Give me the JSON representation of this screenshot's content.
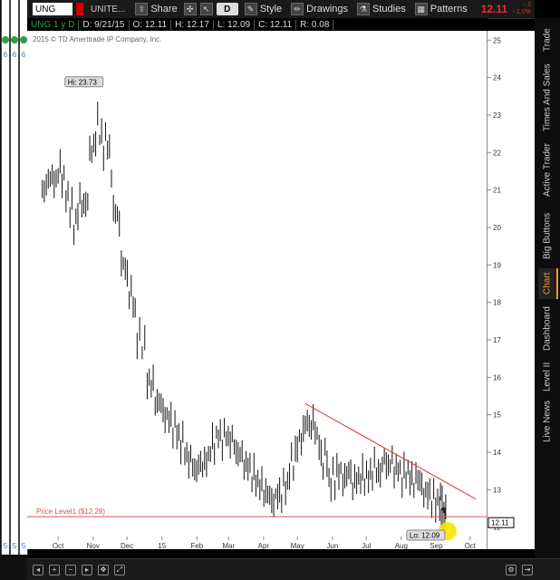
{
  "toolbar": {
    "symbol": "UNG",
    "symbol_name": "UNITE...",
    "share_label": "Share",
    "d_label": "D",
    "style_label": "Style",
    "drawings_label": "Drawings",
    "studies_label": "Studies",
    "patterns_label": "Patterns",
    "last_price": "12.11",
    "change_top": "-.1",
    "change_bottom": "-.1.0%"
  },
  "quote": {
    "symbol_period": "UNG 1 y D",
    "date": "D: 9/21/15",
    "open": "O: 12.11",
    "high": "H: 12.17",
    "low": "L: 12.09",
    "close": "C: 12.11",
    "range": "R: 0.08"
  },
  "chart": {
    "copyright": "2015 © TD Ameritrade IP Company, Inc.",
    "hi_label": "Hi: 23.73",
    "lo_label": "Lo: 12.09",
    "price_level_label": "Price Level1 ($12.28)",
    "last_price_tag": "12.11",
    "colors": {
      "bars": "#111111",
      "trendline": "#e83030",
      "price_level": "#e05050",
      "highlight": "#f5e600"
    }
  },
  "chart_data": {
    "type": "bar",
    "title": "",
    "xlabel": "",
    "ylabel": "",
    "ylim": [
      11.8,
      25.2
    ],
    "y_ticks": [
      12,
      13,
      14,
      15,
      16,
      17,
      18,
      19,
      20,
      21,
      22,
      23,
      24,
      25
    ],
    "x_ticks": [
      "Oct",
      "Nov",
      "Dec",
      "15",
      "Feb",
      "Mar",
      "Apr",
      "May",
      "Jun",
      "Jul",
      "Aug",
      "Sep",
      "Oct"
    ],
    "series": [
      {
        "values": [
          {
            "x": "2014-10-01",
            "y": 20.9
          },
          {
            "x": "2014-10-08",
            "y": 21.9
          },
          {
            "x": "2014-10-15",
            "y": 21.3
          },
          {
            "x": "2014-10-22",
            "y": 20.4
          },
          {
            "x": "2014-10-29",
            "y": 19.4
          },
          {
            "x": "2014-11-05",
            "y": 21.6
          },
          {
            "x": "2014-11-12",
            "y": 22.2
          },
          {
            "x": "2014-11-19",
            "y": 23.4
          },
          {
            "x": "2014-11-26",
            "y": 21.5
          },
          {
            "x": "2014-12-03",
            "y": 19.4
          },
          {
            "x": "2014-12-10",
            "y": 18.9
          },
          {
            "x": "2014-12-17",
            "y": 17.9
          },
          {
            "x": "2014-12-24",
            "y": 16.3
          },
          {
            "x": "2015-01-02",
            "y": 15.6
          },
          {
            "x": "2015-01-09",
            "y": 15.1
          },
          {
            "x": "2015-01-16",
            "y": 14.9
          },
          {
            "x": "2015-01-23",
            "y": 14.6
          },
          {
            "x": "2015-01-30",
            "y": 14.1
          },
          {
            "x": "2015-02-06",
            "y": 13.6
          },
          {
            "x": "2015-02-13",
            "y": 13.4
          },
          {
            "x": "2015-02-20",
            "y": 14.0
          },
          {
            "x": "2015-02-27",
            "y": 14.3
          },
          {
            "x": "2015-03-06",
            "y": 14.6
          },
          {
            "x": "2015-03-13",
            "y": 14.2
          },
          {
            "x": "2015-03-20",
            "y": 13.9
          },
          {
            "x": "2015-03-27",
            "y": 13.6
          },
          {
            "x": "2015-04-03",
            "y": 13.3
          },
          {
            "x": "2015-04-10",
            "y": 13.0
          },
          {
            "x": "2015-04-17",
            "y": 12.8
          },
          {
            "x": "2015-04-24",
            "y": 12.6
          },
          {
            "x": "2015-05-01",
            "y": 13.3
          },
          {
            "x": "2015-05-08",
            "y": 13.9
          },
          {
            "x": "2015-05-15",
            "y": 14.6
          },
          {
            "x": "2015-05-22",
            "y": 15.1
          },
          {
            "x": "2015-05-29",
            "y": 14.5
          },
          {
            "x": "2015-06-05",
            "y": 13.0
          },
          {
            "x": "2015-06-12",
            "y": 13.4
          },
          {
            "x": "2015-06-19",
            "y": 13.7
          },
          {
            "x": "2015-06-26",
            "y": 13.1
          },
          {
            "x": "2015-07-03",
            "y": 13.3
          },
          {
            "x": "2015-07-10",
            "y": 13.5
          },
          {
            "x": "2015-07-17",
            "y": 13.2
          },
          {
            "x": "2015-07-24",
            "y": 13.7
          },
          {
            "x": "2015-07-31",
            "y": 13.8
          },
          {
            "x": "2015-08-07",
            "y": 13.4
          },
          {
            "x": "2015-08-14",
            "y": 13.2
          },
          {
            "x": "2015-08-21",
            "y": 13.6
          },
          {
            "x": "2015-08-28",
            "y": 13.1
          },
          {
            "x": "2015-09-04",
            "y": 12.7
          },
          {
            "x": "2015-09-11",
            "y": 12.8
          },
          {
            "x": "2015-09-18",
            "y": 12.6
          },
          {
            "x": "2015-09-21",
            "y": 12.11
          }
        ]
      }
    ],
    "annotations": [
      {
        "type": "trendline",
        "from": {
          "x": "2015-05-22",
          "y": 15.3
        },
        "to": {
          "x": "2015-10-20",
          "y": 12.75
        }
      },
      {
        "type": "hline",
        "y": 12.28,
        "label": "Price Level1 ($12.28)"
      },
      {
        "type": "high",
        "x": "2014-11-19",
        "y": 23.73,
        "label": "Hi: 23.73"
      },
      {
        "type": "low",
        "x": "2015-09-21",
        "y": 12.09,
        "label": "Lo: 12.09"
      }
    ],
    "grid": false,
    "legend": "none"
  },
  "side_tabs": [
    "Trade",
    "Times And Sales",
    "Active Trader",
    "Big Buttons",
    "Chart",
    "Dashboard",
    "Level II",
    "Live News"
  ],
  "left_strip_marks": [
    "6",
    "6",
    "6",
    "5",
    "5",
    "5"
  ]
}
